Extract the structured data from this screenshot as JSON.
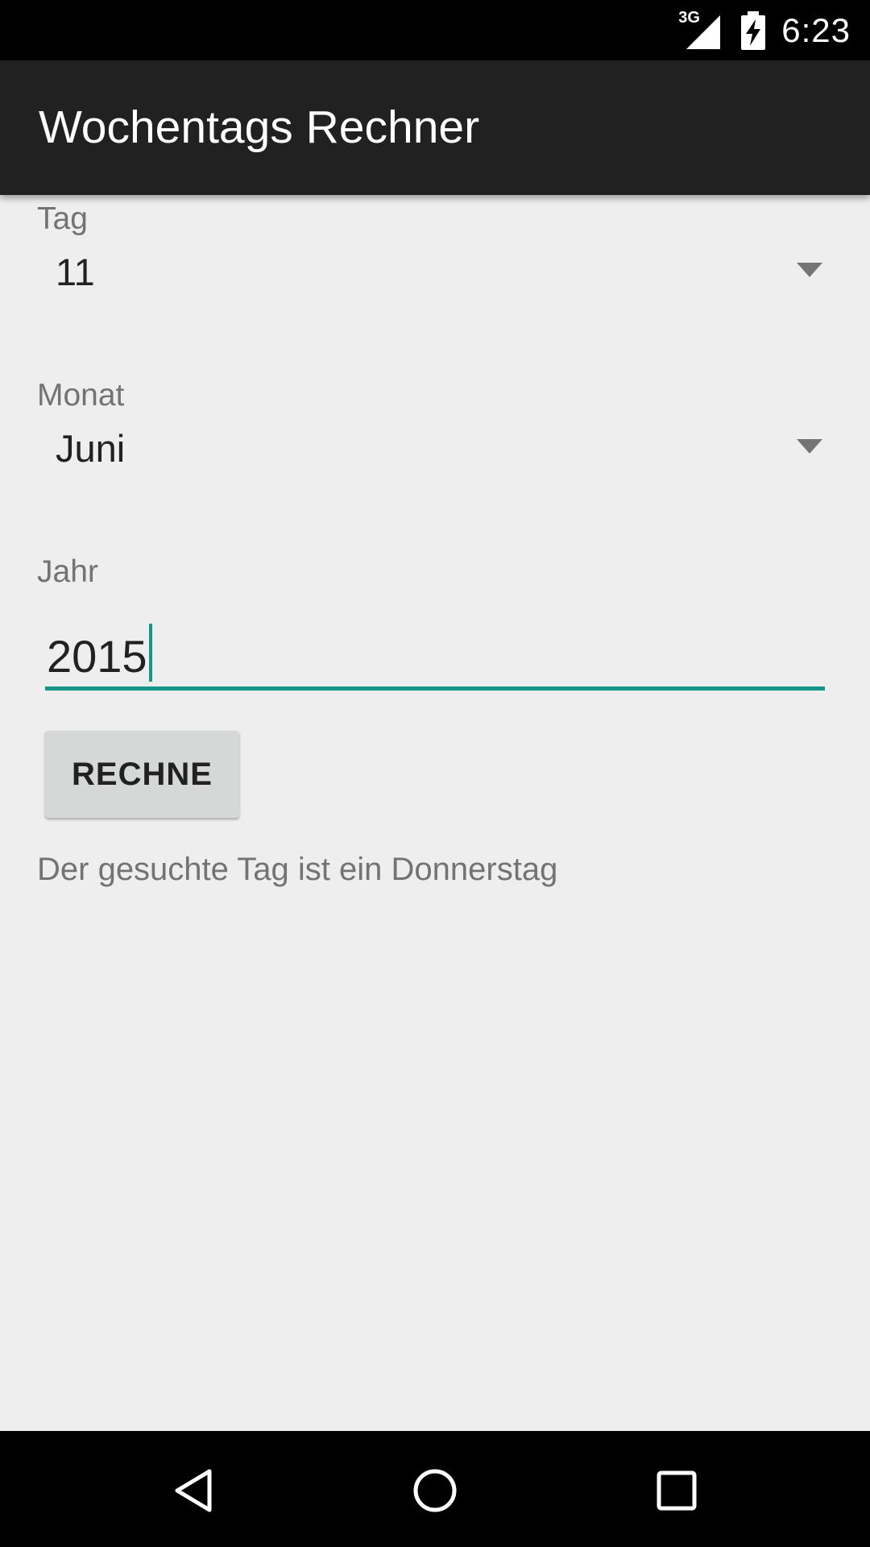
{
  "status_bar": {
    "network": "3G",
    "time": "6:23",
    "icons": [
      "signal-icon",
      "battery-charging-icon"
    ]
  },
  "app_bar": {
    "title": "Wochentags Rechner"
  },
  "form": {
    "day": {
      "label": "Tag",
      "value": "11"
    },
    "month": {
      "label": "Monat",
      "value": "Juni"
    },
    "year": {
      "label": "Jahr",
      "value": "2015"
    },
    "calculate_button": "RECHNE",
    "result": "Der gesuchte Tag ist ein Donnerstag"
  },
  "nav_bar": {
    "icons": [
      "back-icon",
      "home-icon",
      "recents-icon"
    ]
  },
  "colors": {
    "accent": "#159688",
    "app_bar": "#212121",
    "background": "#eeeeee"
  }
}
